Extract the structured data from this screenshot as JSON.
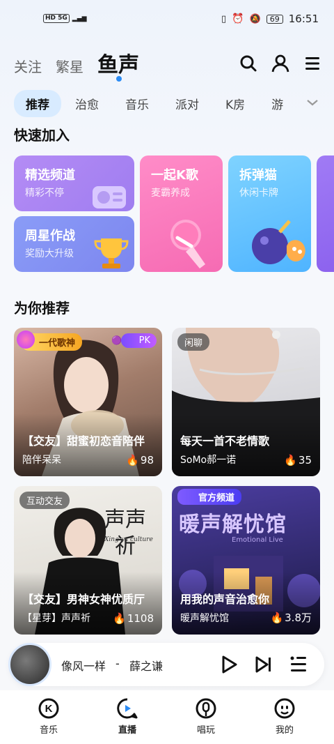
{
  "status_bar": {
    "left": "HD 5G",
    "battery": "69",
    "time": "16:51"
  },
  "top_tabs": [
    "关注",
    "繁星",
    "鱼声"
  ],
  "categories": [
    "推荐",
    "治愈",
    "音乐",
    "派对",
    "K房",
    "游"
  ],
  "quick_join": {
    "title": "快速加入",
    "cards": [
      {
        "title": "精选频道",
        "subtitle": "精彩不停"
      },
      {
        "title": "周星作战",
        "subtitle": "奖励大升级"
      },
      {
        "title": "一起K歌",
        "subtitle": "麦霸养成"
      },
      {
        "title": "拆弹猫",
        "subtitle": "休闲卡牌"
      }
    ]
  },
  "recommend": {
    "title": "为你推荐",
    "rooms": [
      {
        "tag": "一代歌神",
        "badge": "PK",
        "title": "【交友】甜蜜初恋音陪伴",
        "host": "陪伴呆呆",
        "heat": "98"
      },
      {
        "tag": "闲聊",
        "title": "每天一首不老情歌",
        "host": "SoMo郝一诺",
        "heat": "35"
      },
      {
        "tag": "互动交友",
        "poster_text": "声声祈",
        "poster_sub": "Xing ya culture",
        "title": "【交友】男神女神优质厅",
        "host": "【星芽】声声祈",
        "heat": "1108"
      },
      {
        "tag": "官方频道",
        "poster_text": "暖声解忧馆",
        "poster_sub": "Emotional Live",
        "title": "用我的声音治愈你",
        "host": "暖声解忧馆",
        "heat": "3.8万"
      }
    ]
  },
  "player": {
    "song": "像风一样",
    "separator": "-",
    "artist": "薛之谦"
  },
  "bottom_nav": [
    "音乐",
    "直播",
    "唱玩",
    "我的"
  ],
  "colors": {
    "accent": "#2c8cf4",
    "cat_active_bg": "#d8ebff"
  }
}
